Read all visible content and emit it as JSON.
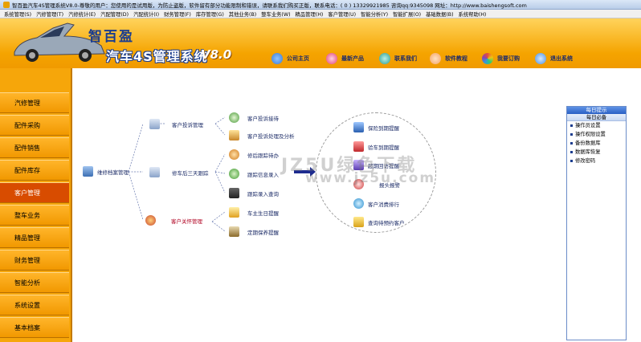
{
  "window": {
    "title": "智百盈汽车4S管理系统V8.0-尊敬的用户：您使用的是试用版，为防止盗版，软件留有部分功能限制和错误，请联系我们购买正版，联系电话：( 0 ) 13329921985 咨询qq:9345098   网址：http://www.baishengsoft.com"
  },
  "menu": [
    "系统管理(S)",
    "汽修管理(T)",
    "汽修统计(E)",
    "汽配管理(D)",
    "汽配统计(I)",
    "财务管理(F)",
    "库存管理(G)",
    "其他业务(B)",
    "整车业务(W)",
    "精品管理(H)",
    "客户管理(U)",
    "智能分析(Y)",
    "智能扩展(O)",
    "基础数据(B)",
    "系统帮助(H)"
  ],
  "header": {
    "logo_line1": "智百盈",
    "logo_line2": "汽车4S管理系统",
    "logo_version": "V8.0",
    "quick_links": [
      {
        "label": "公司主页",
        "icon": "globe-icon",
        "color": "#3a7bd5"
      },
      {
        "label": "最新产品",
        "icon": "flower-icon",
        "color": "#e0407a"
      },
      {
        "label": "联系我们",
        "icon": "link-icon",
        "color": "#2a9d8f"
      },
      {
        "label": "软件教程",
        "icon": "pinwheel-icon",
        "color": "#f4a261"
      },
      {
        "label": "我要订购",
        "icon": "colorwheel-icon",
        "color": "#8e44ad"
      },
      {
        "label": "退出系统",
        "icon": "exit-icon",
        "color": "#4a90e2"
      }
    ]
  },
  "sidebar": {
    "items": [
      "汽修管理",
      "配件采购",
      "配件销售",
      "配件库存",
      "客户管理",
      "整车业务",
      "精品管理",
      "财务管理",
      "智能分析",
      "系统设置",
      "基本档案"
    ],
    "active_index": 4
  },
  "diagram": {
    "root": "维修档案管理",
    "groups": [
      {
        "label": "客户投诉管理",
        "color": "#1a2a66"
      },
      {
        "label": "修车后三天跟踪",
        "color": "#1a2a66"
      },
      {
        "label": "客户关怀管理",
        "color": "#b00020"
      }
    ],
    "leaves": [
      "客户投诉接待",
      "客户投诉处理及分析",
      "修后跟踪待办",
      "跟踪信息录入",
      "跟踪录入查询",
      "车主生日提醒",
      "定期保养提醒"
    ],
    "reminders": [
      "保险到期提醒",
      "验车到期提醒",
      "超期回访提醒",
      "报头报警",
      "客户消费排行",
      "查询待预约客户"
    ]
  },
  "watermark": {
    "line1": "JZ5U绿色下载",
    "line2": "www.jz5u.com"
  },
  "daily_panel": {
    "title": "每日提示",
    "subtitle": "每日必备",
    "items": [
      "操作员设置",
      "操作权限设置",
      "备份数据库",
      "数据库恢复",
      "修改密码"
    ]
  }
}
